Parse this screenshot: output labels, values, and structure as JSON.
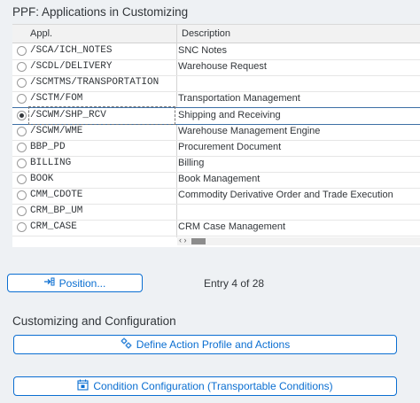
{
  "ppf_section": {
    "title": "PPF: Applications in Customizing",
    "columns": {
      "appl": "Appl.",
      "description": "Description"
    },
    "rows": [
      {
        "appl": "/SCA/ICH_NOTES",
        "description": "SNC Notes",
        "selected": false
      },
      {
        "appl": "/SCDL/DELIVERY",
        "description": "Warehouse Request",
        "selected": false
      },
      {
        "appl": "/SCMTMS/TRANSPORTATION",
        "description": "",
        "selected": false
      },
      {
        "appl": "/SCTM/FOM",
        "description": "Transportation Management",
        "selected": false
      },
      {
        "appl": "/SCWM/SHP_RCV",
        "description": "Shipping and Receiving",
        "selected": true
      },
      {
        "appl": "/SCWM/WME",
        "description": "Warehouse Management Engine",
        "selected": false
      },
      {
        "appl": "BBP_PD",
        "description": "Procurement Document",
        "selected": false
      },
      {
        "appl": "BILLING",
        "description": "Billing",
        "selected": false
      },
      {
        "appl": "BOOK",
        "description": "Book Management",
        "selected": false
      },
      {
        "appl": "CMM_CDOTE",
        "description": "Commodity Derivative Order and Trade Execution",
        "selected": false
      },
      {
        "appl": "CRM_BP_UM",
        "description": "",
        "selected": false
      },
      {
        "appl": "CRM_CASE",
        "description": "CRM Case Management",
        "selected": false
      }
    ],
    "scroll_arrows": "‹ ›",
    "position_button": {
      "label": "Position...",
      "icon": "position-arrow-icon"
    },
    "entry_text": "Entry 4 of 28"
  },
  "customizing_section": {
    "title": "Customizing and Configuration",
    "buttons": [
      {
        "label": "Define Action Profile and Actions",
        "icon": "action-profile-icon"
      },
      {
        "label": "Condition Configuration (Transportable Conditions)",
        "icon": "condition-config-icon"
      }
    ]
  },
  "colors": {
    "accent": "#0a6ed1",
    "background": "#eef1f4",
    "selection_border": "#3d6fa5"
  }
}
